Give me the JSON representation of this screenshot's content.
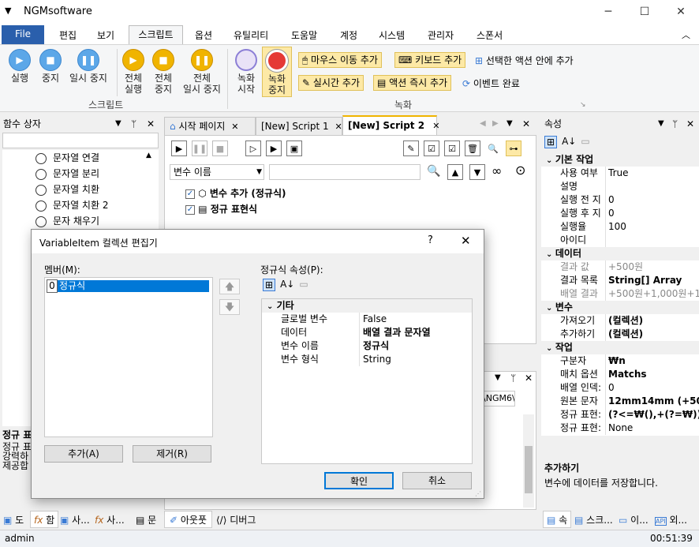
{
  "app": {
    "title": "NGMsoftware",
    "icon": "menu-icon"
  },
  "menu": {
    "file": "File",
    "items": [
      "편집",
      "보기",
      "스크립트",
      "옵션",
      "유틸리티",
      "도움말",
      "계정",
      "시스템",
      "관리자",
      "스폰서"
    ]
  },
  "ribbon": {
    "script_buttons": [
      {
        "label": "실행"
      },
      {
        "label": "중지"
      },
      {
        "label": "일시 중지"
      }
    ],
    "all_buttons": [
      {
        "l1": "전체",
        "l2": "실행"
      },
      {
        "l1": "전체",
        "l2": "중지"
      },
      {
        "l1": "전체",
        "l2": "일시 중지"
      }
    ],
    "record_buttons": [
      {
        "l1": "녹화",
        "l2": "시작"
      },
      {
        "l1": "녹화",
        "l2": "중지"
      }
    ],
    "script_group": "스크립트",
    "record_group": "녹화",
    "mouse_move_add": "마우스 이동 추가",
    "keyboard_add": "키보드 추가",
    "add_in_selected_action": "선택한 액션 안에 추가",
    "realtime_add": "실시간 추가",
    "action_immediate_add": "액션 즉시 추가",
    "event_complete": "이벤트 완료"
  },
  "function_box": {
    "title": "함수 상자",
    "items": [
      "문자열 연결",
      "문자열 분리",
      "문자열 치환",
      "문자열 치환 2",
      "문자 채우기"
    ],
    "desc_title": "정규 표",
    "desc_lines": [
      "정규 표",
      "강력하",
      "제공합"
    ]
  },
  "doc_tabs": [
    "시작 페이지",
    "[New] Script 1",
    "[New] Script 2"
  ],
  "script": {
    "var_select": "변수 이름",
    "nodes": [
      {
        "label": "변수 추가 (정규식)"
      },
      {
        "label": "정규 표현식"
      }
    ]
  },
  "output": {
    "path": "ts\\NGM6\\",
    "tail": "..........................."
  },
  "bottom_tabs_left": [
    "도",
    "함",
    "사...",
    "사...",
    "문"
  ],
  "bottom_tabs_mid": [
    "아웃풋",
    "디버그"
  ],
  "properties": {
    "title": "속성",
    "rows": [
      {
        "k": "기본 작업",
        "cat": true
      },
      {
        "k": "사용 여부",
        "v": "True"
      },
      {
        "k": "설명",
        "v": ""
      },
      {
        "k": "실행 전 지",
        "v": "0"
      },
      {
        "k": "실행 후 지",
        "v": "0"
      },
      {
        "k": "실행율",
        "v": "100"
      },
      {
        "k": "아이디",
        "v": ""
      },
      {
        "k": "데이터",
        "cat": true
      },
      {
        "k": "결과 값",
        "v": "+500원",
        "gray": true
      },
      {
        "k": "결과 목록",
        "v": "String[] Array",
        "bold": true
      },
      {
        "k": "배열 결과",
        "v": "+500원+1,000원+1,500",
        "gray": true
      },
      {
        "k": "변수",
        "cat": true
      },
      {
        "k": "가져오기",
        "v": "(컬렉션)",
        "bold": true
      },
      {
        "k": "추가하기",
        "v": "(컬렉션)",
        "bold": true
      },
      {
        "k": "작업",
        "cat": true
      },
      {
        "k": "구분자",
        "v": "₩n",
        "bold": true
      },
      {
        "k": "매치 옵션",
        "v": "Matchs",
        "bold": true
      },
      {
        "k": "배열 인덱:",
        "v": "0"
      },
      {
        "k": "원본 문자",
        "v": "12mm14mm (+500",
        "bold": true
      },
      {
        "k": "정규 표현:",
        "v": "(?<=₩(),+(?=₩))",
        "bold": true
      },
      {
        "k": "정규 표현:",
        "v": "None"
      }
    ],
    "help_title": "추가하기",
    "help_text": "변수에 데이터를 저장합니다.",
    "bottom_tabs": [
      "속",
      "스크...",
      "이...",
      "외..."
    ]
  },
  "dialog": {
    "title": "VariableItem 컬렉션 편집기",
    "help": "?",
    "members_label": "멤버(M):",
    "member_index": "0",
    "member_value": "정규식",
    "props_label": "정규식 속성(P):",
    "category": "기타",
    "props": [
      {
        "k": "글로벌 변수",
        "v": "False",
        "bold": false
      },
      {
        "k": "데이터",
        "v": "배열 결과 문자열",
        "bold": true
      },
      {
        "k": "변수 이름",
        "v": "정규식",
        "bold": true
      },
      {
        "k": "변수 형식",
        "v": "String",
        "bold": false
      }
    ],
    "add": "추가(A)",
    "remove": "제거(R)",
    "ok": "확인",
    "cancel": "취소"
  },
  "status": {
    "user": "admin",
    "time": "00:51:39"
  }
}
